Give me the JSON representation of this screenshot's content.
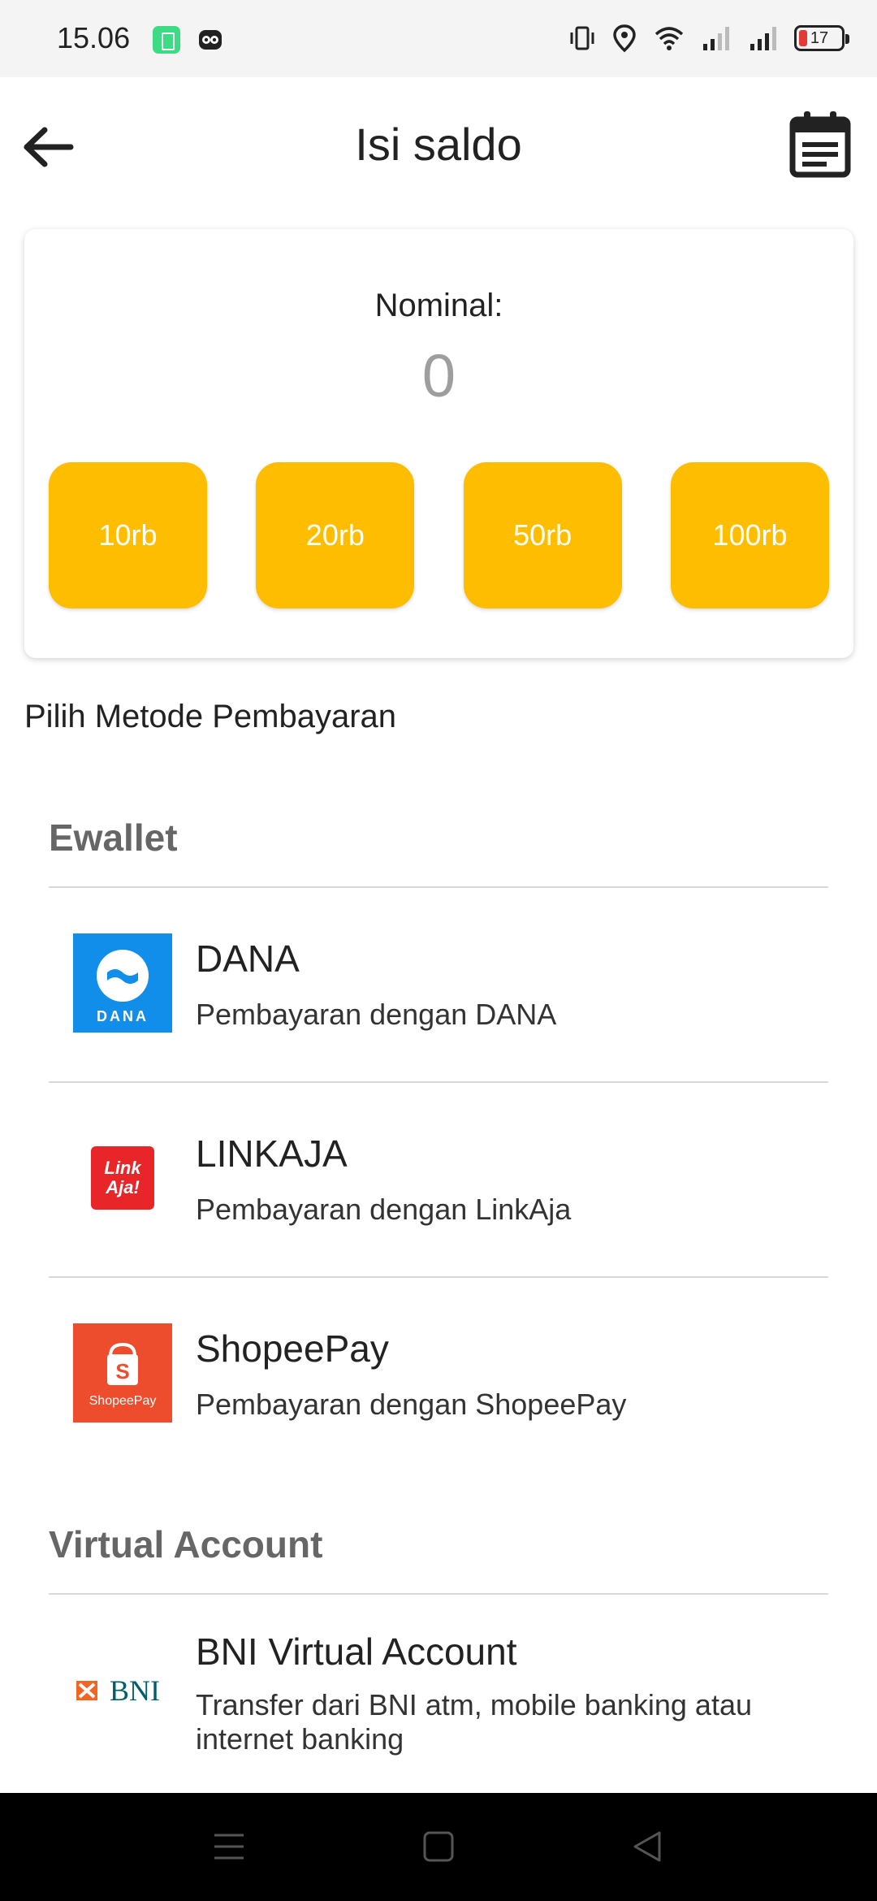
{
  "status_bar": {
    "time": "15.06",
    "battery_level": "17",
    "icons": [
      "battery-saver-icon",
      "owl-app-icon",
      "vibrate-icon",
      "location-icon",
      "wifi-icon",
      "signal-icon",
      "signal-icon-2",
      "battery-icon"
    ]
  },
  "header": {
    "title": "Isi saldo",
    "back_icon": "arrow-left-icon",
    "history_icon": "calendar-icon"
  },
  "nominal": {
    "label": "Nominal:",
    "value": "0",
    "options": [
      {
        "label": "10rb"
      },
      {
        "label": "20rb"
      },
      {
        "label": "50rb"
      },
      {
        "label": "100rb"
      }
    ],
    "accent_color": "#ffbd00"
  },
  "payment": {
    "prompt": "Pilih Metode Pembayaran",
    "groups": [
      {
        "title": "Ewallet",
        "methods": [
          {
            "name": "DANA",
            "desc": "Pembayaran dengan DANA",
            "logo": "dana-logo",
            "logo_text": "DANA"
          },
          {
            "name": "LINKAJA",
            "desc": "Pembayaran dengan LinkAja",
            "logo": "linkaja-logo",
            "logo_text": "Link Aja!"
          },
          {
            "name": "ShopeePay",
            "desc": "Pembayaran dengan ShopeePay",
            "logo": "shopeepay-logo",
            "logo_text": "ShopeePay"
          }
        ]
      },
      {
        "title": "Virtual Account",
        "methods": [
          {
            "name": "BNI Virtual Account",
            "desc": "Transfer dari BNI atm, mobile banking atau internet banking",
            "logo": "bni-logo",
            "logo_text": "BNI"
          }
        ]
      }
    ]
  },
  "nav_bar": {
    "icons": [
      "menu-icon",
      "home-icon",
      "back-triangle-icon"
    ]
  }
}
